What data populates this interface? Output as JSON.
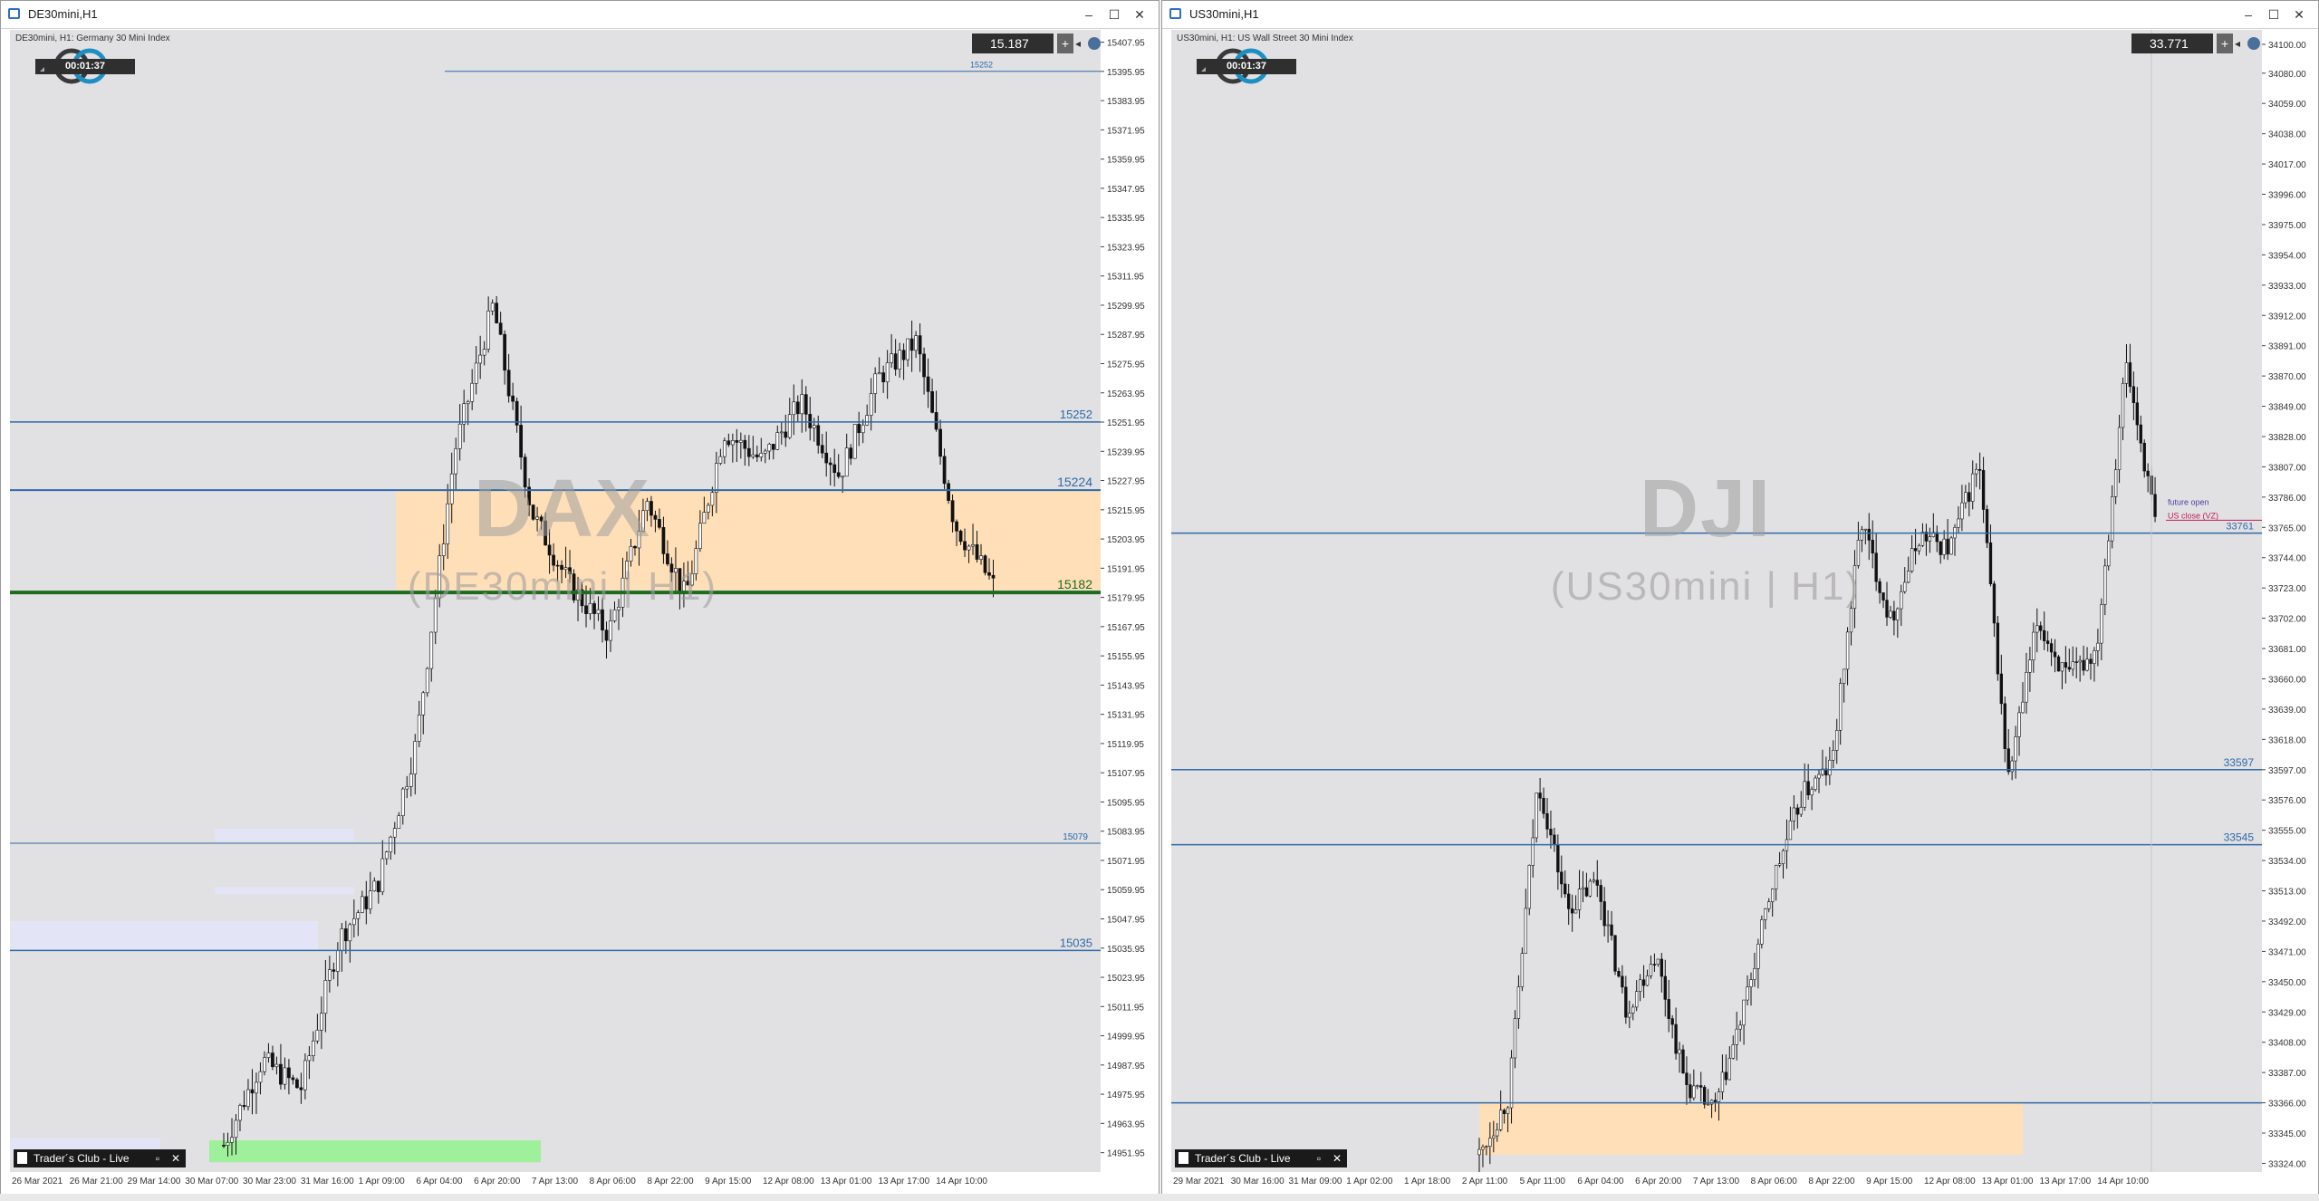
{
  "colors": {
    "bg": "#e1e0e3",
    "bull": "#ffffff",
    "bear": "#111111",
    "wick": "#111111",
    "level": "#2e6aa6",
    "zone": "#ffdfb8",
    "support": "#1e6b1e",
    "green_zone": "#9ff09a",
    "lavender": "#e3e5f7",
    "logo_ring": "#1d8fc0"
  },
  "left": {
    "window_title": "DE30mini,H1",
    "info": "DE30mini, H1: Germany 30 Mini Index",
    "timer": "00:01:37",
    "price_box": "15.187",
    "symbol": "DAX",
    "subsymbol": "(DE30mini | H1)",
    "trader_club": "Trader´s Club - Live",
    "y_ticks": [
      "15407.95",
      "15395.95",
      "15383.95",
      "15371.95",
      "15359.95",
      "15347.95",
      "15335.95",
      "15323.95",
      "15311.95",
      "15299.95",
      "15287.95",
      "15275.95",
      "15263.95",
      "15251.95",
      "15239.95",
      "15227.95",
      "15215.95",
      "15203.95",
      "15191.95",
      "15179.95",
      "15167.95",
      "15155.95",
      "15143.95",
      "15131.95",
      "15119.95",
      "15107.95",
      "15095.95",
      "15083.95",
      "15071.95",
      "15059.95",
      "15047.95",
      "15035.95",
      "15023.95",
      "15011.95",
      "14999.95",
      "14987.95",
      "14975.95",
      "14963.95",
      "14951.95"
    ],
    "x_ticks": [
      "26 Mar 2021",
      "26 Mar 21:00",
      "29 Mar 14:00",
      "30 Mar 07:00",
      "30 Mar 23:00",
      "31 Mar 16:00",
      "1 Apr 09:00",
      "6 Apr 04:00",
      "6 Apr 20:00",
      "7 Apr 13:00",
      "8 Apr 06:00",
      "8 Apr 22:00",
      "9 Apr 15:00",
      "12 Apr 08:00",
      "13 Apr 01:00",
      "13 Apr 17:00",
      "14 Apr 10:00"
    ],
    "level_labels": [
      "15252",
      "15224",
      "15182",
      "15079",
      "15035",
      "15252"
    ]
  },
  "right": {
    "window_title": "US30mini,H1",
    "info": "US30mini, H1: US Wall Street 30 Mini Index",
    "timer": "00:01:37",
    "price_box": "33.771",
    "symbol": "DJI",
    "subsymbol": "(US30mini | H1)",
    "trader_club": "Trader´s Club - Live",
    "y_ticks": [
      "34100.00",
      "34080.00",
      "34059.00",
      "34038.00",
      "34017.00",
      "33996.00",
      "33975.00",
      "33954.00",
      "33933.00",
      "33912.00",
      "33891.00",
      "33870.00",
      "33849.00",
      "33828.00",
      "33807.00",
      "33786.00",
      "33765.00",
      "33744.00",
      "33723.00",
      "33702.00",
      "33681.00",
      "33660.00",
      "33639.00",
      "33618.00",
      "33597.00",
      "33576.00",
      "33555.00",
      "33534.00",
      "33513.00",
      "33492.00",
      "33471.00",
      "33450.00",
      "33429.00",
      "33408.00",
      "33387.00",
      "33366.00",
      "33345.00",
      "33324.00"
    ],
    "x_ticks": [
      "29 Mar 2021",
      "30 Mar 16:00",
      "31 Mar 09:00",
      "1 Apr 02:00",
      "1 Apr 18:00",
      "2 Apr 11:00",
      "5 Apr 11:00",
      "6 Apr 04:00",
      "6 Apr 20:00",
      "7 Apr 13:00",
      "8 Apr 06:00",
      "8 Apr 22:00",
      "9 Apr 15:00",
      "12 Apr 08:00",
      "13 Apr 01:00",
      "13 Apr 17:00",
      "14 Apr 10:00"
    ],
    "level_labels": [
      "33761",
      "33597",
      "33545"
    ],
    "future_open": "future open",
    "us_close": "US close (VZ)"
  }
}
